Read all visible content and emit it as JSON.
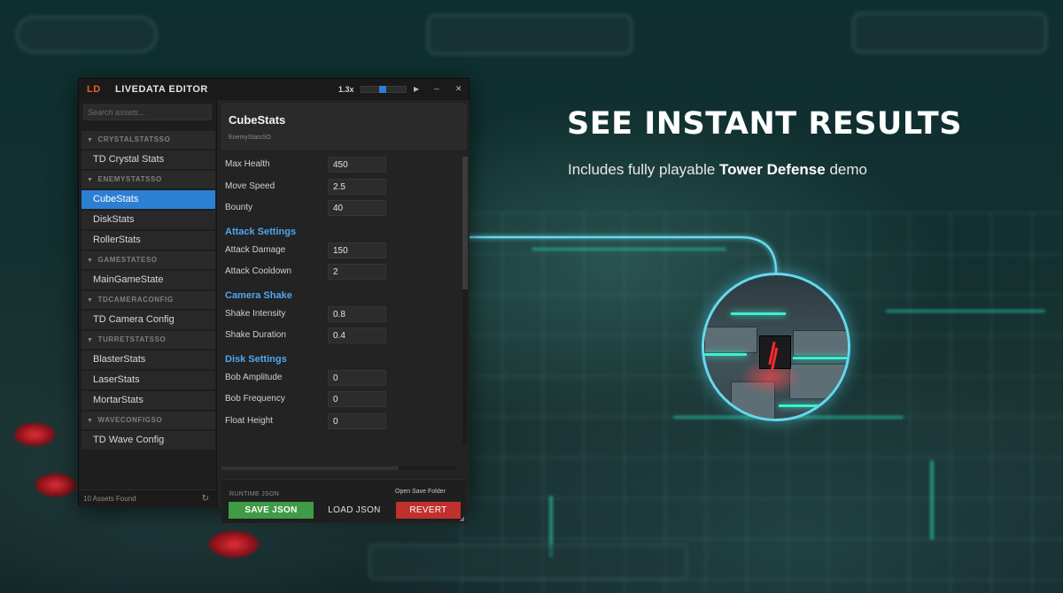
{
  "headline": "SEE INSTANT RESULTS",
  "subline": {
    "before": "Includes fully playable ",
    "bold": "Tower Defense",
    "after": " demo"
  },
  "editor": {
    "logo": "LD",
    "title": "LIVEDATA EDITOR",
    "zoom": "1.3x",
    "zoom_level_fraction": 0.45,
    "play_icon": "▶",
    "minimize_icon": "_",
    "close_icon": "✕",
    "search_placeholder": "Search assets...",
    "groups": [
      {
        "header": "CRYSTALSTATSSO",
        "items": [
          "TD Crystal Stats"
        ]
      },
      {
        "header": "ENEMYSTATSSO",
        "items": [
          "CubeStats",
          "DiskStats",
          "RollerStats"
        ]
      },
      {
        "header": "GAMESTATESO",
        "items": [
          "MainGameState"
        ]
      },
      {
        "header": "TDCAMERACONFIG",
        "items": [
          "TD Camera Config"
        ]
      },
      {
        "header": "TURRETSTATSSO",
        "items": [
          "BlasterStats",
          "LaserStats",
          "MortarStats"
        ]
      },
      {
        "header": "WAVECONFIGSO",
        "items": [
          "TD Wave Config"
        ]
      }
    ],
    "selected_item": "CubeStats",
    "assets_found": "10 Assets Found",
    "asset": {
      "name": "CubeStats",
      "type": "EnemyStatsSO"
    },
    "properties": [
      {
        "label": "Max Health",
        "value": "450"
      },
      {
        "label": "Move Speed",
        "value": "2.5"
      },
      {
        "label": "Bounty",
        "value": "40"
      }
    ],
    "sections": [
      {
        "title": "Attack Settings",
        "fields": [
          {
            "label": "Attack Damage",
            "value": "150"
          },
          {
            "label": "Attack Cooldown",
            "value": "2"
          }
        ]
      },
      {
        "title": "Camera Shake",
        "fields": [
          {
            "label": "Shake Intensity",
            "value": "0.8"
          },
          {
            "label": "Shake Duration",
            "value": "0.4"
          }
        ]
      },
      {
        "title": "Disk Settings",
        "fields": [
          {
            "label": "Bob Amplitude",
            "value": "0"
          },
          {
            "label": "Bob Frequency",
            "value": "0"
          },
          {
            "label": "Float Height",
            "value": "0"
          }
        ]
      }
    ],
    "footer": {
      "runtime_label": "RUNTIME JSON",
      "open_save_folder": "Open Save Folder",
      "save_json": "SAVE JSON",
      "load_json": "LOAD JSON",
      "revert": "REVERT"
    }
  },
  "colors": {
    "accent_blue": "#2d7fd3",
    "section_blue": "#4fa6f0",
    "save_green": "#3f9b46",
    "revert_red": "#c0302c",
    "logo_orange": "#e2612b",
    "connector_cyan": "#66d9f0"
  }
}
